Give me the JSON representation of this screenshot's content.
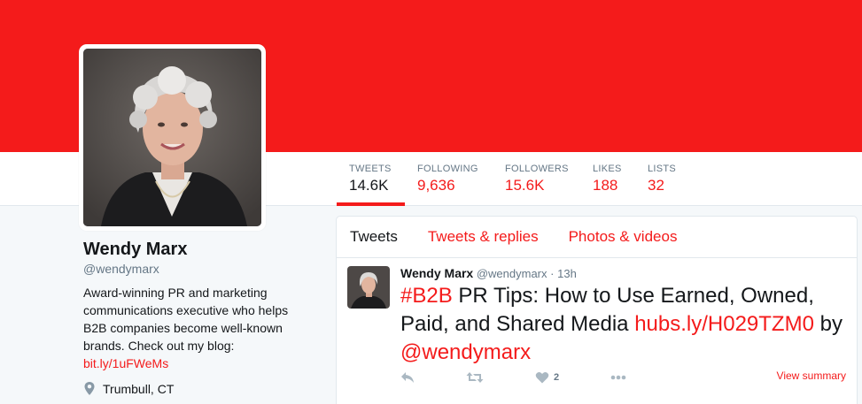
{
  "colors": {
    "brand": "#f41b1b",
    "text": "#14171a",
    "muted": "#657786",
    "background": "#f5f8fa"
  },
  "profile": {
    "name": "Wendy Marx",
    "handle": "@wendymarx",
    "bio": "Award-winning PR and marketing communications executive who helps B2B companies become well-known brands. Check out my blog:",
    "bio_link": "bit.ly/1uFWeMs",
    "location": "Trumbull, CT",
    "location_icon": "map-pin-icon"
  },
  "stats": [
    {
      "label": "TWEETS",
      "value": "14.6K"
    },
    {
      "label": "FOLLOWING",
      "value": "9,636"
    },
    {
      "label": "FOLLOWERS",
      "value": "15.6K"
    },
    {
      "label": "LIKES",
      "value": "188"
    },
    {
      "label": "LISTS",
      "value": "32"
    }
  ],
  "timeline": {
    "tabs": [
      "Tweets",
      "Tweets & replies",
      "Photos & videos"
    ],
    "tweet": {
      "name": "Wendy Marx",
      "handle": "@wendymarx",
      "separator": "·",
      "time": "13h",
      "hashtag": "#B2B",
      "text": " PR Tips: How to Use Earned, Owned, Paid, and Shared Media ",
      "link": "hubs.ly/H029TZM0",
      "by": " by ",
      "mention": "@wendymarx",
      "like_count": "2",
      "view_summary": "View summary",
      "icons": [
        "reply-icon",
        "retweet-icon",
        "heart-icon",
        "more-icon"
      ]
    }
  }
}
